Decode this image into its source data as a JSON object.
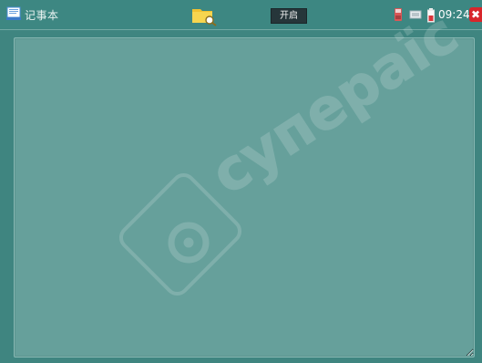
{
  "app": {
    "title": "记事本",
    "icon": "notepad-icon"
  },
  "toolbar": {
    "folder_icon": "folder-search-icon",
    "open_label": "开启"
  },
  "status": {
    "time": "09:24",
    "icons": [
      "sd-card-icon",
      "network-icon",
      "battery-icon"
    ],
    "close_label": "✖"
  },
  "editor": {
    "content": ""
  },
  "watermark": {
    "text": "cупераїс"
  },
  "colors": {
    "background": "#3f8580",
    "text_area": "#66a09b",
    "open_button": "#26363a",
    "close_button": "#d8262b",
    "folder": "#f2c230"
  }
}
